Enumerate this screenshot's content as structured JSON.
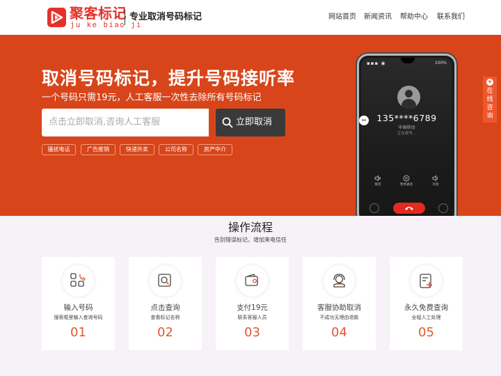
{
  "header": {
    "logo_cn": "聚客标记",
    "logo_pinyin": "ju ke biao ji",
    "slogan": "专业取消号码标记",
    "nav": [
      "网站首页",
      "新闻资讯",
      "帮助中心",
      "联系我们"
    ]
  },
  "hero": {
    "title": "取消号码标记，提升号码接听率",
    "subtitle": "一个号码只需19元，人工客服一次性去除所有号码标记",
    "search_placeholder": "点击立即取消,咨询人工客服",
    "search_button": "立即取消",
    "tags": [
      "骚扰电话",
      "广告推销",
      "快递外卖",
      "公司名称",
      "房产中介"
    ],
    "background_color": "#d8451a"
  },
  "phone": {
    "status_left": "▪▪▪ ◉",
    "battery": "100%",
    "number": "135****6789",
    "carrier": "中国移动",
    "state": "正在拨号...",
    "controls": [
      "静音",
      "暂停通话",
      "外放"
    ]
  },
  "consult_tab": {
    "label": "在线咨询"
  },
  "process": {
    "title": "操作流程",
    "subtitle": "告别错误标记，增加来电信任",
    "steps": [
      {
        "title": "输入号码",
        "desc": "搜索框里输入查询号码",
        "num": "01",
        "icon": "phone-grid-icon"
      },
      {
        "title": "点击查询",
        "desc": "查看标记名称",
        "num": "02",
        "icon": "search-card-icon"
      },
      {
        "title": "支付19元",
        "desc": "联系客服人员",
        "num": "03",
        "icon": "wallet-icon"
      },
      {
        "title": "客服协助取消",
        "desc": "不成功无理由退款",
        "num": "04",
        "icon": "headset-icon"
      },
      {
        "title": "永久免费查询",
        "desc": "全程人工处理",
        "num": "05",
        "icon": "document-add-icon"
      }
    ],
    "accent_color": "#e4572e"
  }
}
